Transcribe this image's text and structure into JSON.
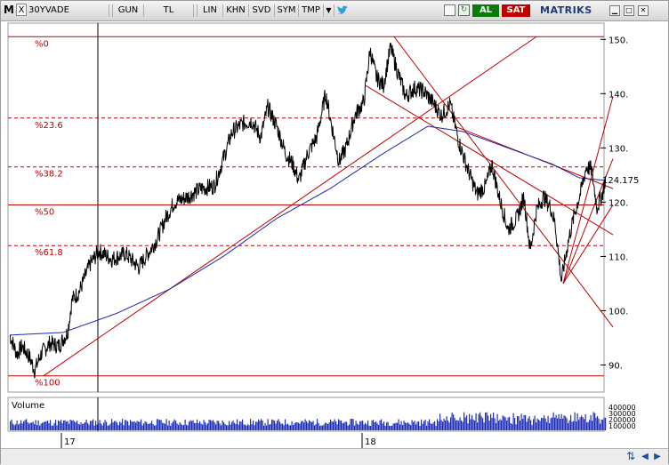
{
  "toolbar": {
    "logo_letter": "M",
    "close_glyph": "X",
    "symbol": "30YVADE",
    "items": [
      "GUN",
      "TL",
      "LIN",
      "KHN",
      "SVD",
      "SYM",
      "TMP"
    ],
    "dropdown_glyph": "▼",
    "buy_label": "AL",
    "sell_label": "SAT",
    "brand": "MATRIKS",
    "icons": [
      "new-window-icon",
      "copy-icon",
      "refresh-icon",
      "twitter-icon",
      "grid-icon",
      "minimize-icon",
      "maximize-icon",
      "close-icon"
    ]
  },
  "colors": {
    "price": "#000000",
    "moving_average": "#1c2aa8",
    "fibo": "#c00000",
    "volume": "#1f2fb8",
    "fibo_label": "#c00000"
  },
  "chart_data": {
    "type": "line",
    "symbol": "30YVADE",
    "ylim": [
      85,
      153
    ],
    "y_ticks": [
      90,
      100,
      110,
      120,
      130,
      140,
      150
    ],
    "last_price_label": "124.175",
    "x_tick_labels": [
      "17",
      "18"
    ],
    "fibonacci_levels": [
      {
        "label": "%0",
        "value": 150.5
      },
      {
        "label": "%23.6",
        "value": 135.5
      },
      {
        "label": "%38.2",
        "value": 126.5
      },
      {
        "label": "%50",
        "value": 119.5
      },
      {
        "label": "%61.8",
        "value": 112.0
      },
      {
        "label": "%100",
        "value": 88.0
      }
    ],
    "price_anchors": [
      [
        0,
        95.5
      ],
      [
        8,
        92
      ],
      [
        14,
        93.5
      ],
      [
        22,
        91.5
      ],
      [
        28,
        89
      ],
      [
        35,
        92
      ],
      [
        45,
        94
      ],
      [
        55,
        93.5
      ],
      [
        65,
        96
      ],
      [
        70,
        102
      ],
      [
        78,
        103.5
      ],
      [
        90,
        108.5
      ],
      [
        100,
        111
      ],
      [
        115,
        109.5
      ],
      [
        130,
        110.5
      ],
      [
        145,
        108
      ],
      [
        155,
        110.5
      ],
      [
        165,
        113
      ],
      [
        175,
        117
      ],
      [
        185,
        120
      ],
      [
        200,
        121
      ],
      [
        215,
        122.5
      ],
      [
        230,
        123
      ],
      [
        240,
        128
      ],
      [
        250,
        133
      ],
      [
        262,
        134.5
      ],
      [
        272,
        135
      ],
      [
        282,
        132
      ],
      [
        290,
        137.5
      ],
      [
        300,
        134
      ],
      [
        310,
        129
      ],
      [
        318,
        127
      ],
      [
        325,
        124
      ],
      [
        335,
        129
      ],
      [
        345,
        132
      ],
      [
        355,
        140
      ],
      [
        362,
        134
      ],
      [
        370,
        127.5
      ],
      [
        378,
        130
      ],
      [
        388,
        136
      ],
      [
        398,
        138.5
      ],
      [
        405,
        148
      ],
      [
        412,
        143
      ],
      [
        420,
        141.5
      ],
      [
        428,
        148.5
      ],
      [
        436,
        144
      ],
      [
        445,
        139.5
      ],
      [
        455,
        141
      ],
      [
        465,
        140.5
      ],
      [
        475,
        138.5
      ],
      [
        485,
        136
      ],
      [
        495,
        138
      ],
      [
        505,
        131
      ],
      [
        515,
        126
      ],
      [
        525,
        121.5
      ],
      [
        535,
        123
      ],
      [
        542,
        127
      ],
      [
        550,
        121
      ],
      [
        560,
        115
      ],
      [
        570,
        117
      ],
      [
        578,
        121
      ],
      [
        585,
        111
      ],
      [
        592,
        118.5
      ],
      [
        600,
        121
      ],
      [
        608,
        119
      ],
      [
        613,
        116
      ],
      [
        620,
        105.5
      ],
      [
        628,
        113
      ],
      [
        635,
        118
      ],
      [
        642,
        122
      ],
      [
        648,
        126.5
      ],
      [
        654,
        126
      ],
      [
        660,
        119
      ],
      [
        666,
        121.5
      ],
      [
        670,
        124.5
      ]
    ],
    "moving_average_anchors": [
      [
        0,
        95.5
      ],
      [
        60,
        96
      ],
      [
        120,
        99.5
      ],
      [
        180,
        104
      ],
      [
        240,
        110
      ],
      [
        300,
        117
      ],
      [
        360,
        122.5
      ],
      [
        420,
        129
      ],
      [
        470,
        134
      ],
      [
        510,
        133
      ],
      [
        560,
        130
      ],
      [
        610,
        127
      ],
      [
        640,
        124.5
      ],
      [
        670,
        124
      ]
    ],
    "trendlines": [
      {
        "from": [
          38,
          88
        ],
        "to": [
          592,
          150.5
        ]
      },
      {
        "from": [
          432,
          150.5
        ],
        "to": [
          678,
          97
        ]
      },
      {
        "from": [
          400,
          141.5
        ],
        "to": [
          678,
          114
        ]
      },
      {
        "from": [
          500,
          134
        ],
        "to": [
          678,
          122.5
        ]
      },
      {
        "from": [
          622,
          105
        ],
        "to": [
          678,
          139.5
        ]
      },
      {
        "from": [
          622,
          105
        ],
        "to": [
          678,
          128
        ]
      },
      {
        "from": [
          622,
          105
        ],
        "to": [
          678,
          119.5
        ]
      }
    ],
    "volume": {
      "label": "Volume",
      "y_ticks": [
        "400000",
        "300000",
        "200000",
        "100000"
      ]
    }
  }
}
